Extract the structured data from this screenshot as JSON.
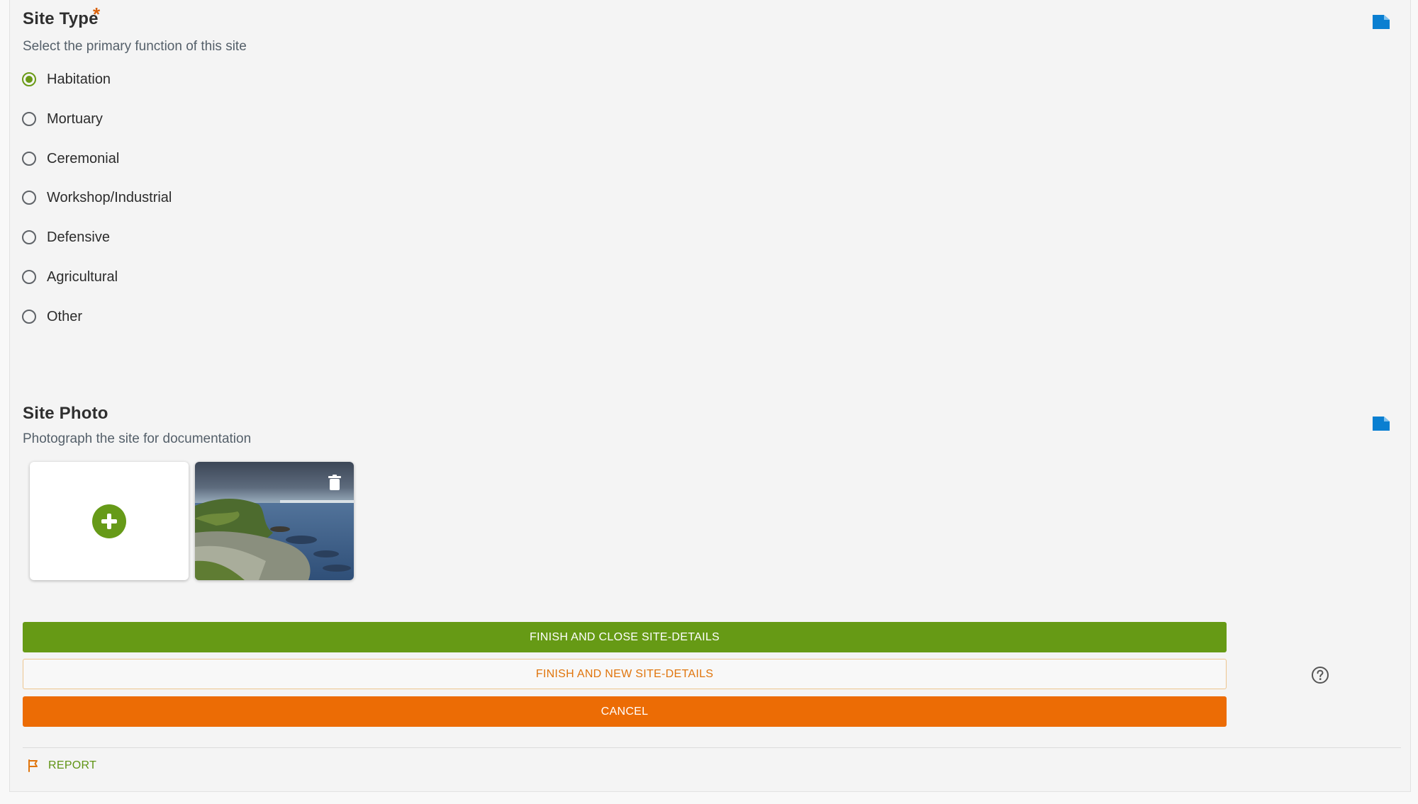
{
  "site_type": {
    "title": "Site Type",
    "required_marker": "*",
    "description": "Select the primary function of this site",
    "selected": "Habitation",
    "options": [
      {
        "label": "Habitation",
        "checked": true
      },
      {
        "label": "Mortuary",
        "checked": false
      },
      {
        "label": "Ceremonial",
        "checked": false
      },
      {
        "label": "Workshop/Industrial",
        "checked": false
      },
      {
        "label": "Defensive",
        "checked": false
      },
      {
        "label": "Agricultural",
        "checked": false
      },
      {
        "label": "Other",
        "checked": false
      }
    ]
  },
  "site_photo": {
    "title": "Site Photo",
    "description": "Photograph the site for documentation",
    "photo_count": 1
  },
  "actions": {
    "finish_close": "FINISH AND CLOSE SITE-DETAILS",
    "finish_new": "FINISH AND NEW SITE-DETAILS",
    "cancel": "CANCEL",
    "report": "REPORT"
  },
  "icons": {
    "save": "save-note-icon",
    "add": "plus-circle-icon",
    "delete": "trash-icon",
    "help": "help-circle-icon",
    "report": "flag-icon"
  },
  "colors": {
    "primary_green": "#669a15",
    "accent_orange": "#ec6c05",
    "save_icon_blue": "#0a7fd1"
  }
}
